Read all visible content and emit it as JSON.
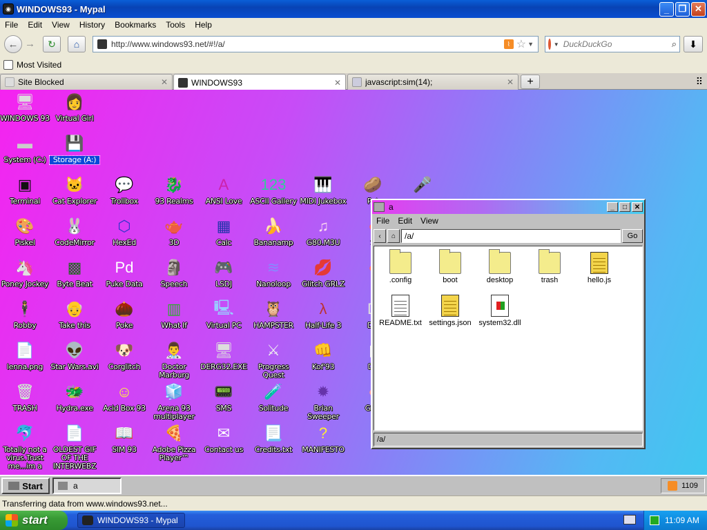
{
  "window": {
    "title": "WINDOWS93 - Mypal"
  },
  "menu": [
    "File",
    "Edit",
    "View",
    "History",
    "Bookmarks",
    "Tools",
    "Help"
  ],
  "address": {
    "url": "http://www.windows93.net/#!/a/"
  },
  "search": {
    "placeholder": "DuckDuckGo"
  },
  "bookmarks": {
    "most_visited": "Most Visited"
  },
  "tabs": [
    {
      "title": "Site Blocked"
    },
    {
      "title": "WINDOWS93"
    },
    {
      "title": "javascript:sim(14);"
    }
  ],
  "desktop": {
    "icons": [
      {
        "label": "WINDOWS 93",
        "glyph": "🖥"
      },
      {
        "label": "Virtual Girl",
        "glyph": "👩"
      },
      {
        "label": "System (C:)",
        "glyph": "▬"
      },
      {
        "label": "Storage (A:)",
        "glyph": "💾"
      },
      {
        "label": "Terminal",
        "glyph": "▣"
      },
      {
        "label": "Cat Explorer",
        "glyph": "🐱"
      },
      {
        "label": "Trollbox",
        "glyph": "💬"
      },
      {
        "label": "93 Realms",
        "glyph": "🐉"
      },
      {
        "label": "ANSI Love",
        "glyph": "A"
      },
      {
        "label": "ASCII Gallery",
        "glyph": "123"
      },
      {
        "label": "MIDI Jukebox",
        "glyph": "🎹"
      },
      {
        "label": "Pot",
        "glyph": "🥔"
      },
      {
        "label": "",
        "glyph": "🎤"
      },
      {
        "label": "Piskel",
        "glyph": "🎨"
      },
      {
        "label": "CodeMirror",
        "glyph": "🐰"
      },
      {
        "label": "HexEd",
        "glyph": "⬡"
      },
      {
        "label": "3D",
        "glyph": "🫖"
      },
      {
        "label": "Calc",
        "glyph": "▦"
      },
      {
        "label": "Bananamp",
        "glyph": "🍌"
      },
      {
        "label": "G80.M3U",
        "glyph": "♫"
      },
      {
        "label": "S",
        "glyph": "●"
      },
      {
        "label": "Poney Jockey",
        "glyph": "🦄"
      },
      {
        "label": "Byte Beat",
        "glyph": "▩"
      },
      {
        "label": "Puke Data",
        "glyph": "Pd"
      },
      {
        "label": "Speech",
        "glyph": "🗿"
      },
      {
        "label": "LSDJ",
        "glyph": "🎮"
      },
      {
        "label": "Nanoloop",
        "glyph": "≋"
      },
      {
        "label": "Glitch GRLZ",
        "glyph": "💋"
      },
      {
        "label": "F",
        "glyph": "●"
      },
      {
        "label": "Robby",
        "glyph": "🕴"
      },
      {
        "label": "Take this",
        "glyph": "👴"
      },
      {
        "label": "Poke",
        "glyph": "🌰"
      },
      {
        "label": "What If",
        "glyph": "▥"
      },
      {
        "label": "Virtual PC",
        "glyph": "🖳"
      },
      {
        "label": "HAMPSTER",
        "glyph": "🦉"
      },
      {
        "label": "Half-Life 3",
        "glyph": "λ"
      },
      {
        "label": "DO",
        "glyph": "D"
      },
      {
        "label": "lenna.png",
        "glyph": "📄"
      },
      {
        "label": "Star Wars.avi",
        "glyph": "👽"
      },
      {
        "label": "Corglitch",
        "glyph": "🐶"
      },
      {
        "label": "Doctor Marburg",
        "glyph": "👨‍⚕️"
      },
      {
        "label": "DERG32.EXE",
        "glyph": "🖥"
      },
      {
        "label": "Progress Quest",
        "glyph": "⚔"
      },
      {
        "label": "Kof'93",
        "glyph": "👊"
      },
      {
        "label": "De",
        "glyph": "▮"
      },
      {
        "label": "TRASH",
        "glyph": "🗑"
      },
      {
        "label": "Hydra.exe",
        "glyph": "🐲"
      },
      {
        "label": "Acid Box 93",
        "glyph": "☺"
      },
      {
        "label": "Arena 93 multiplayer",
        "glyph": "🧊"
      },
      {
        "label": "SMS",
        "glyph": "📟"
      },
      {
        "label": "Solitude",
        "glyph": "🧪"
      },
      {
        "label": "Brian Sweeper",
        "glyph": "✹"
      },
      {
        "label": "GAR",
        "glyph": "●"
      },
      {
        "label": "Totally not a virus.Trust me...im a",
        "glyph": "🐬"
      },
      {
        "label": "OLDEST GIF OF THE INTERWEBZ",
        "glyph": "📄"
      },
      {
        "label": "SIM 93",
        "glyph": "📖"
      },
      {
        "label": "Adobe Pizza Player™",
        "glyph": "🍕"
      },
      {
        "label": "Contact us",
        "glyph": "✉"
      },
      {
        "label": "Credits.txt",
        "glyph": "📃"
      },
      {
        "label": "MANIFESTO",
        "glyph": "?"
      }
    ]
  },
  "explorer": {
    "title": "a",
    "menu": [
      "File",
      "Edit",
      "View"
    ],
    "path": "/a/",
    "go": "Go",
    "files": [
      {
        "name": ".config",
        "kind": "folder"
      },
      {
        "name": "boot",
        "kind": "folder"
      },
      {
        "name": "desktop",
        "kind": "folder"
      },
      {
        "name": "trash",
        "kind": "folder"
      },
      {
        "name": "hello.js",
        "kind": "js"
      },
      {
        "name": "README.txt",
        "kind": "txt"
      },
      {
        "name": "settings.json",
        "kind": "js"
      },
      {
        "name": "system32.dll",
        "kind": "dll"
      }
    ],
    "status": "/a/"
  },
  "w93_taskbar": {
    "start": "Start",
    "task": "a",
    "clock": "1109"
  },
  "status_text": "Transferring data from www.windows93.net...",
  "xp_taskbar": {
    "start": "start",
    "task": "WINDOWS93 - Mypal",
    "clock": "11:09 AM"
  }
}
